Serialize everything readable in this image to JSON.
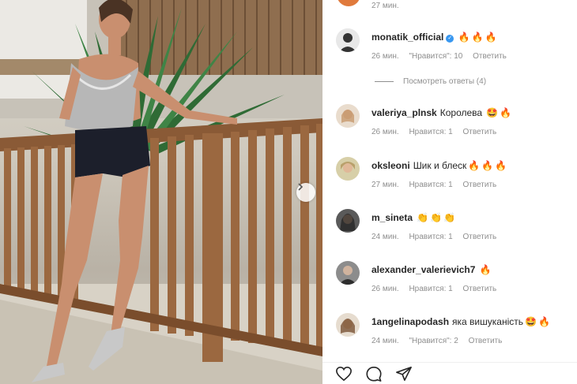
{
  "post": {
    "top_comment_time": "27 мин.",
    "view_replies": "Посмотреть ответы (4)"
  },
  "comments": [
    {
      "user": "monatik_official",
      "verified": true,
      "text": "",
      "emoji": [
        "🔥",
        "🔥",
        "🔥"
      ],
      "time": "26 мин.",
      "likes": "\"Нравится\": 10",
      "reply": "Ответить",
      "avatar_color": "#dcdcdc"
    },
    {
      "user": "valeriya_plnsk",
      "verified": false,
      "text": "Королева",
      "emoji": [
        "🤩",
        "🔥"
      ],
      "time": "26 мин.",
      "likes": "Нравится: 1",
      "reply": "Ответить",
      "avatar_color": "#c79a6e"
    },
    {
      "user": "oksleoni",
      "verified": false,
      "text": "Шик и блеск",
      "emoji": [
        "🔥",
        "🔥",
        "🔥"
      ],
      "time": "27 мин.",
      "likes": "Нравится: 1",
      "reply": "Ответить",
      "avatar_color": "#b9a06b"
    },
    {
      "user": "m_sineta",
      "verified": false,
      "text": "",
      "emoji": [
        "👏",
        "👏",
        "👏"
      ],
      "time": "24 мин.",
      "likes": "Нравится: 1",
      "reply": "Ответить",
      "avatar_color": "#3a3a3a"
    },
    {
      "user": "alexander_valerievich7",
      "verified": false,
      "text": "",
      "emoji": [
        "🔥"
      ],
      "time": "26 мин.",
      "likes": "Нравится: 1",
      "reply": "Ответить",
      "avatar_color": "#4a4a4a"
    },
    {
      "user": "1angelinapodash",
      "verified": false,
      "text": "яка вишуканість",
      "emoji": [
        "🤩",
        "🔥"
      ],
      "time": "24 мин.",
      "likes": "\"Нравится\": 2",
      "reply": "Ответить",
      "avatar_color": "#b08a68"
    }
  ],
  "icons": {
    "like": "heart-icon",
    "comment": "comment-icon",
    "share": "share-icon",
    "next": "chevron-right-icon"
  }
}
